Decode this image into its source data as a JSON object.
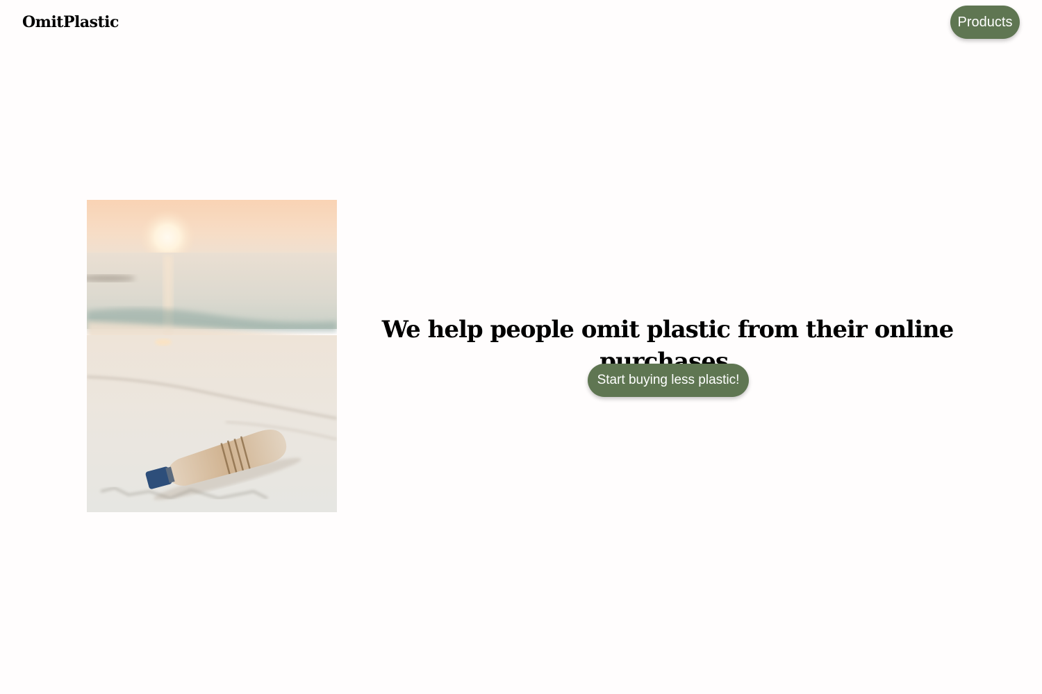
{
  "header": {
    "logo_text": "OmitPlastic",
    "nav_products_label": "Products"
  },
  "hero": {
    "image_icon": "beach-plastic-bottle-photo",
    "headline": "We help people omit plastic from their online purchases.",
    "cta_label": "Start buying less plastic!"
  },
  "colors": {
    "accent": "#5f7652",
    "background": "#fffdfd",
    "text": "#000000"
  }
}
